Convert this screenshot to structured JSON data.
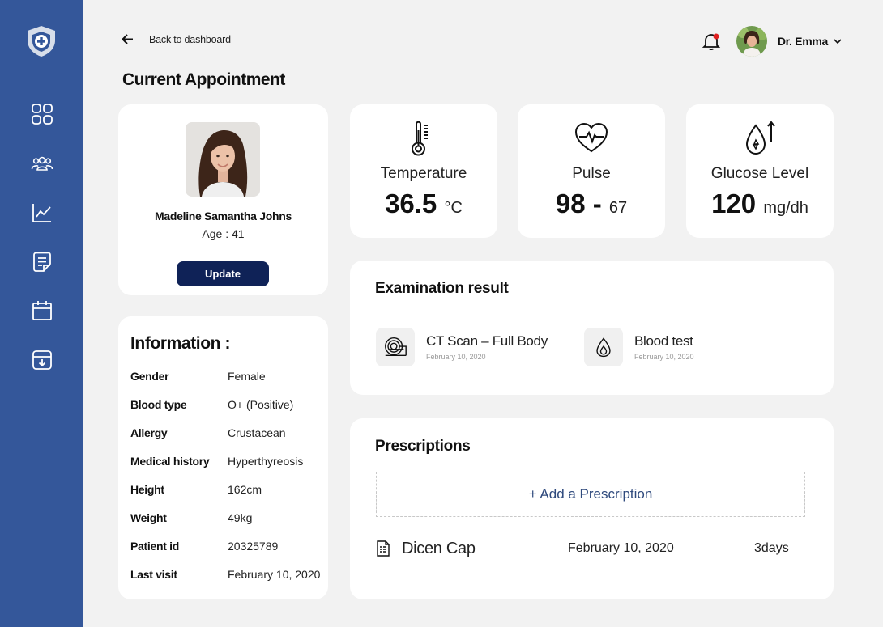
{
  "colors": {
    "sidebar": "#34579a",
    "primary_button": "#0f2257",
    "accent_link": "#2f4a7d",
    "notification_dot": "#e02020"
  },
  "sidebar": {
    "items": [
      {
        "name": "dashboard",
        "icon": "grid-icon"
      },
      {
        "name": "patients",
        "icon": "users-icon"
      },
      {
        "name": "analytics",
        "icon": "chart-icon"
      },
      {
        "name": "records",
        "icon": "document-icon"
      },
      {
        "name": "calendar",
        "icon": "calendar-icon"
      },
      {
        "name": "archive",
        "icon": "archive-icon"
      }
    ]
  },
  "header": {
    "back_label": "Back to dashboard",
    "user_name": "Dr. Emma"
  },
  "page": {
    "title": "Current Appointment"
  },
  "patient": {
    "name": "Madeline Samantha Johns",
    "age": "Age : 41",
    "update_label": "Update"
  },
  "information": {
    "title": "Information :",
    "rows": [
      {
        "key": "Gender",
        "value": "Female"
      },
      {
        "key": "Blood type",
        "value": "O+ (Positive)"
      },
      {
        "key": "Allergy",
        "value": "Crustacean"
      },
      {
        "key": "Medical history",
        "value": "Hyperthyreosis"
      },
      {
        "key": "Height",
        "value": "162cm"
      },
      {
        "key": "Weight",
        "value": "49kg"
      },
      {
        "key": "Patient id",
        "value": "20325789"
      },
      {
        "key": "Last visit",
        "value": "February 10, 2020"
      }
    ]
  },
  "vitals": [
    {
      "label": "Temperature",
      "value": "36.5",
      "unit": "°C",
      "icon": "thermometer-icon"
    },
    {
      "label": "Pulse",
      "value": "98 -",
      "unit": "67",
      "icon": "heart-pulse-icon"
    },
    {
      "label": "Glucose Level",
      "value": "120",
      "unit": "mg/dh",
      "icon": "glucose-drop-icon"
    }
  ],
  "examination": {
    "title": "Examination result",
    "items": [
      {
        "name": "CT Scan – Full Body",
        "date": "February  10, 2020",
        "icon": "ct-scan-icon"
      },
      {
        "name": "Blood test",
        "date": "February  10, 2020",
        "icon": "blood-drop-icon"
      }
    ]
  },
  "prescriptions": {
    "title": "Prescriptions",
    "add_label": "+ Add a Prescription",
    "items": [
      {
        "name": "Dicen Cap",
        "date": "February 10, 2020",
        "duration": "3days"
      }
    ]
  }
}
